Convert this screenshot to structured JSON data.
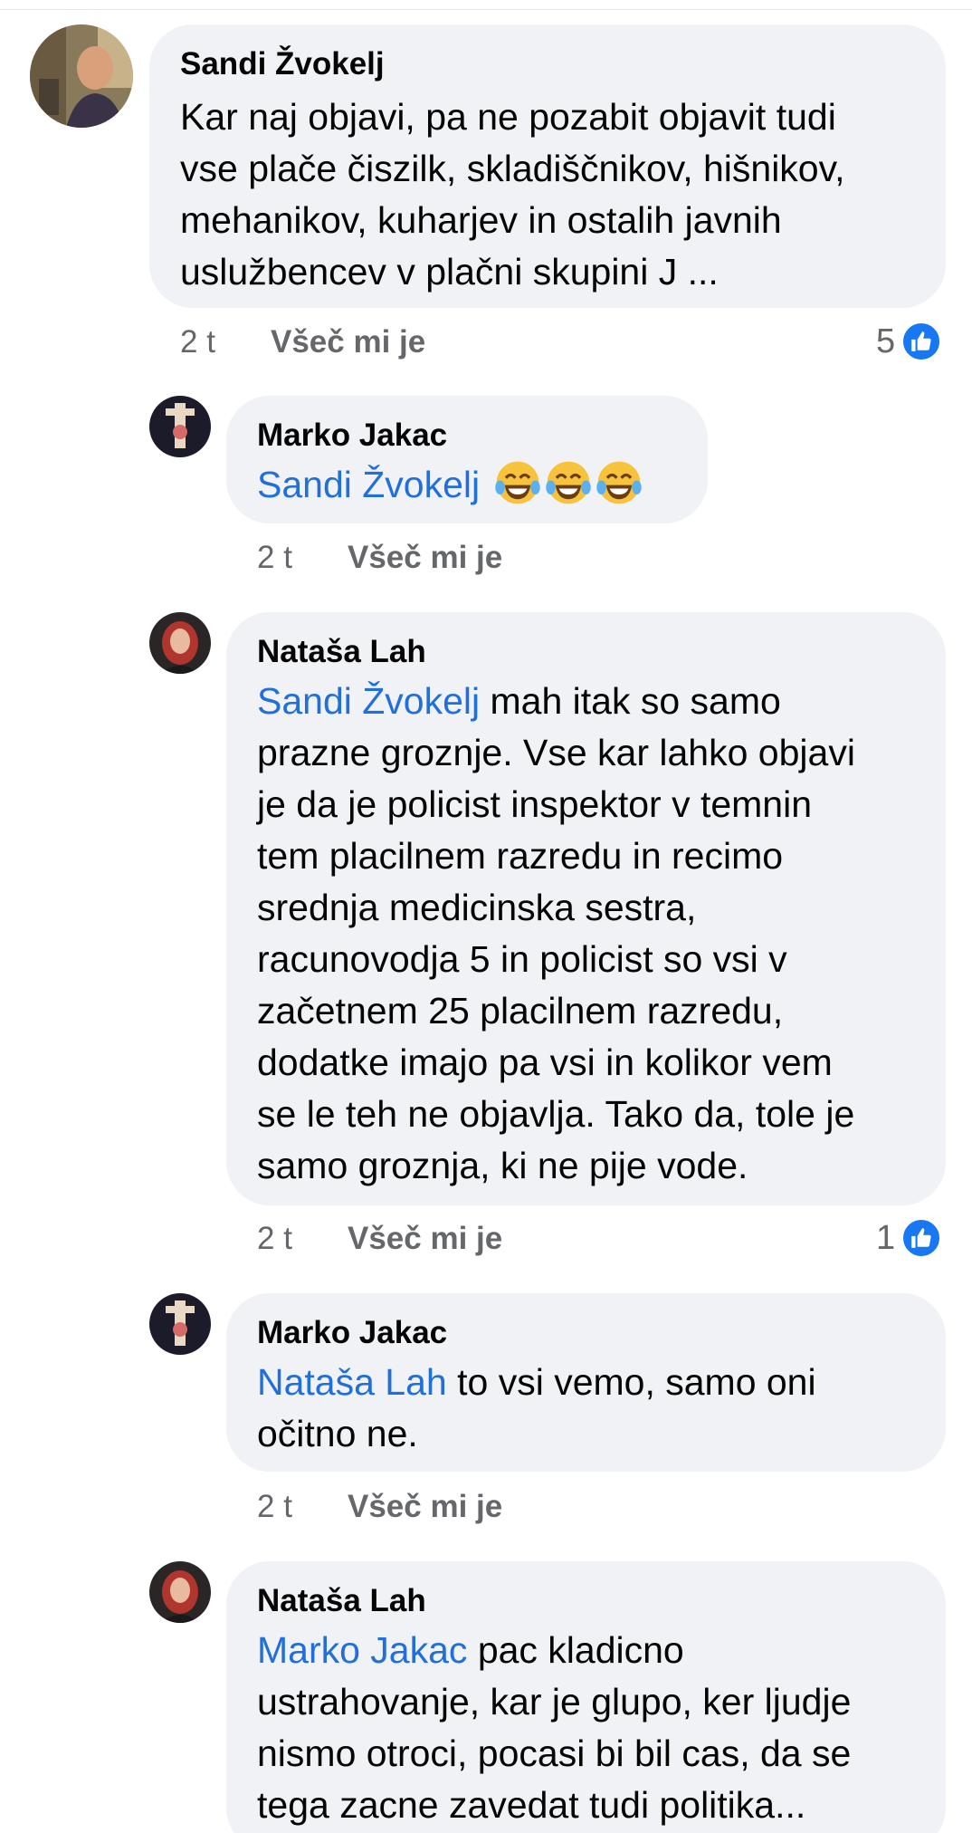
{
  "comments": [
    {
      "author": "Sandi Žvokelj",
      "text_lines": [
        "Kar naj objavi, pa ne pozabit objavit tudi",
        "vse plače čiszilk, skladiščnikov, hišnikov,",
        "mehanikov, kuharjev in ostalih javnih",
        "uslužbencev v plačni skupini J ..."
      ],
      "time": "2 t",
      "like_label": "Všeč mi je",
      "reaction_count": "5"
    },
    {
      "author": "Marko Jakac",
      "mention": "Sandi Žvokelj",
      "emojis": [
        "tears-of-joy",
        "tears-of-joy",
        "tears-of-joy"
      ],
      "time": "2 t",
      "like_label": "Všeč mi je"
    },
    {
      "author": "Nataša Lah",
      "mention": "Sandi Žvokelj",
      "first_line_rest": " mah itak so samo",
      "text_lines": [
        "prazne groznje. Vse kar lahko objavi",
        "je da je policist inspektor v temnin",
        "tem placilnem razredu in recimo",
        "srednja medicinska sestra,",
        "racunovodja 5 in policist so vsi v",
        "začetnem 25 placilnem razredu,",
        "dodatke imajo pa vsi in kolikor vem",
        "se le teh ne objavlja. Tako da, tole je",
        "samo groznja, ki ne pije vode."
      ],
      "time": "2 t",
      "like_label": "Všeč mi je",
      "reaction_count": "1"
    },
    {
      "author": "Marko Jakac",
      "mention": "Nataša Lah",
      "first_line_rest": " to vsi vemo, samo oni",
      "text_lines": [
        "očitno ne."
      ],
      "time": "2 t",
      "like_label": "Všeč mi je"
    },
    {
      "author": "Nataša Lah",
      "mention": "Marko Jakac",
      "first_line_rest": " pac kladicno",
      "text_lines": [
        "ustrahovanje, kar je glupo, ker ljudje",
        "nismo otroci, pocasi bi bil cas, da se",
        "tega zacne zavedat tudi politika..."
      ]
    }
  ],
  "colors": {
    "bubble": "#f0f2f5",
    "mention": "#216fdb",
    "meta": "#65676b",
    "like_badge": "#1877f2"
  }
}
